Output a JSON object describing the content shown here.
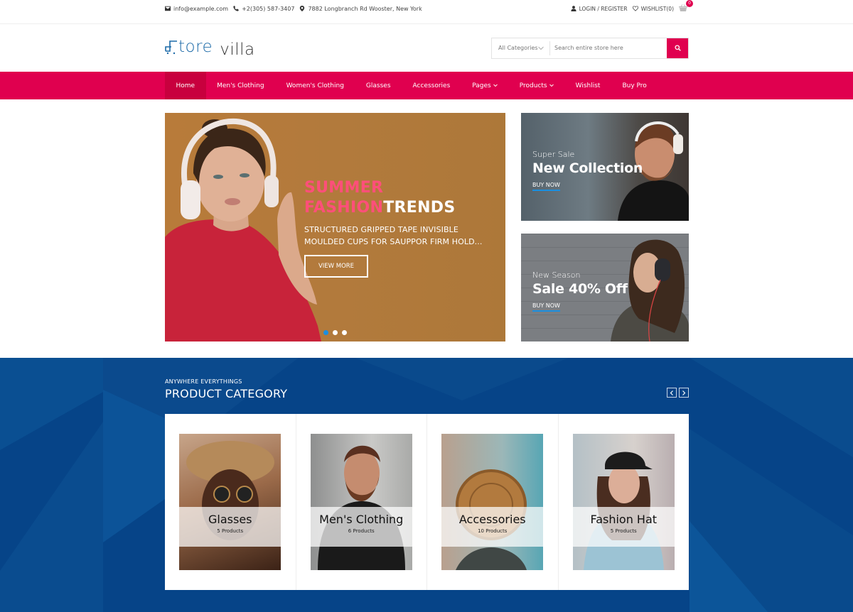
{
  "topbar": {
    "email": "info@example.com",
    "phone": "+2(305) 587-3407",
    "address": "7882 Longbranch Rd Wooster, New York",
    "login_label": "LOGIN / REGISTER",
    "wishlist_label": "WISHLIST(0)",
    "cart_count": "0"
  },
  "header": {
    "logo_part1": "tore",
    "logo_part2": "villa",
    "search": {
      "category_selected": "All Categories",
      "placeholder": "Search entire store here"
    }
  },
  "nav": {
    "items": [
      {
        "label": "Home",
        "active": true
      },
      {
        "label": "Men's Clothing"
      },
      {
        "label": "Women's Clothing"
      },
      {
        "label": "Glasses"
      },
      {
        "label": "Accessories"
      },
      {
        "label": "Pages",
        "dropdown": true
      },
      {
        "label": "Products",
        "dropdown": true
      },
      {
        "label": "Wishlist"
      },
      {
        "label": "Buy Pro"
      }
    ]
  },
  "slider": {
    "title_pink_1": "SUMMER",
    "title_pink_2": "FASHION",
    "title_white": "TRENDS",
    "description": "STRUCTURED GRIPPED TAPE INVISIBLE MOULDED CUPS FOR SAUPPOR FIRM HOLD...",
    "button_label": "VIEW MORE",
    "slide_count": 3,
    "active_slide": 1
  },
  "banners": [
    {
      "subtitle": "Super Sale",
      "title": "New Collection",
      "link": "BUY NOW"
    },
    {
      "subtitle": "New Season",
      "title": "Sale 40% Off",
      "link": "BUY NOW"
    }
  ],
  "category_section": {
    "subtitle": "ANYWHERE EVERYTHINGS",
    "title": "PRODUCT CATEGORY",
    "categories": [
      {
        "name": "Glasses",
        "count": "5 Products"
      },
      {
        "name": "Men's Clothing",
        "count": "6 Products"
      },
      {
        "name": "Accessories",
        "count": "10 Products"
      },
      {
        "name": "Fashion Hat",
        "count": "5 Products"
      }
    ]
  },
  "colors": {
    "brand_pink": "#e0004f",
    "nav_active": "#c8003e",
    "section_blue": "#064488",
    "accent_blue": "#1a8fe0",
    "logo_blue": "#1c6aa8",
    "slider_pink": "#ff4f7a"
  }
}
